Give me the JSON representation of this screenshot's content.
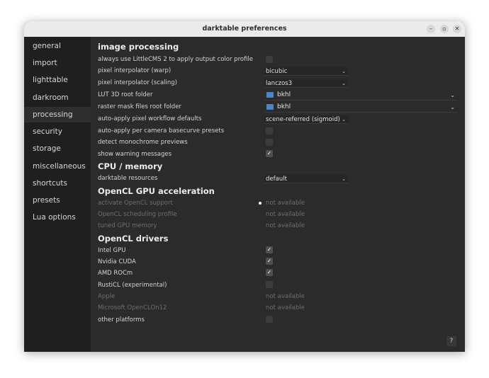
{
  "window": {
    "title": "darktable preferences",
    "controls": {
      "minimize": "–",
      "maximize": "▫",
      "close": "✕"
    }
  },
  "sidebar": {
    "items": [
      {
        "label": "general"
      },
      {
        "label": "import"
      },
      {
        "label": "lighttable"
      },
      {
        "label": "darkroom"
      },
      {
        "label": "processing",
        "active": true
      },
      {
        "label": "security"
      },
      {
        "label": "storage"
      },
      {
        "label": "miscellaneous"
      },
      {
        "label": "shortcuts"
      },
      {
        "label": "presets"
      },
      {
        "label": "Lua options"
      }
    ]
  },
  "sections": {
    "image_processing": "image processing",
    "cpu_memory": "CPU / memory",
    "opencl_gpu": "OpenCL GPU acceleration",
    "opencl_drivers": "OpenCL drivers"
  },
  "image_processing": {
    "littlecms": {
      "label": "always use LittleCMS 2 to apply output color profile",
      "checked": false
    },
    "warp": {
      "label": "pixel interpolator (warp)",
      "value": "bicubic"
    },
    "scaling": {
      "label": "pixel interpolator (scaling)",
      "value": "lanczos3"
    },
    "lut3d": {
      "label": "LUT 3D root folder",
      "value": "bkhl"
    },
    "raster": {
      "label": "raster mask files root folder",
      "value": "bkhl"
    },
    "workflow": {
      "label": "auto-apply pixel workflow defaults",
      "value": "scene-referred (sigmoid)"
    },
    "basecurve": {
      "label": "auto-apply per camera basecurve presets",
      "checked": false
    },
    "monochrome": {
      "label": "detect monochrome previews",
      "checked": false
    },
    "warnings": {
      "label": "show warning messages",
      "checked": true
    }
  },
  "cpu_memory": {
    "resources": {
      "label": "darktable resources",
      "value": "default"
    }
  },
  "opencl_gpu": {
    "activate": {
      "label": "activate OpenCL support",
      "value": "not available"
    },
    "scheduling": {
      "label": "OpenCL scheduling profile",
      "value": "not available"
    },
    "tuned": {
      "label": "tuned GPU memory",
      "value": "not available"
    }
  },
  "opencl_drivers": {
    "intel": {
      "label": "Intel GPU",
      "checked": true
    },
    "nvidia": {
      "label": "Nvidia CUDA",
      "checked": true
    },
    "amd": {
      "label": "AMD ROCm",
      "checked": true
    },
    "rusticl": {
      "label": "RustiCL (experimental)",
      "checked": false
    },
    "apple": {
      "label": "Apple",
      "value": "not available"
    },
    "microsoft": {
      "label": "Microsoft OpenCLOn12",
      "value": "not available"
    },
    "other": {
      "label": "other platforms",
      "checked": false
    }
  },
  "icons": {
    "check": "✓",
    "chevron": "⌄",
    "help": "?"
  }
}
